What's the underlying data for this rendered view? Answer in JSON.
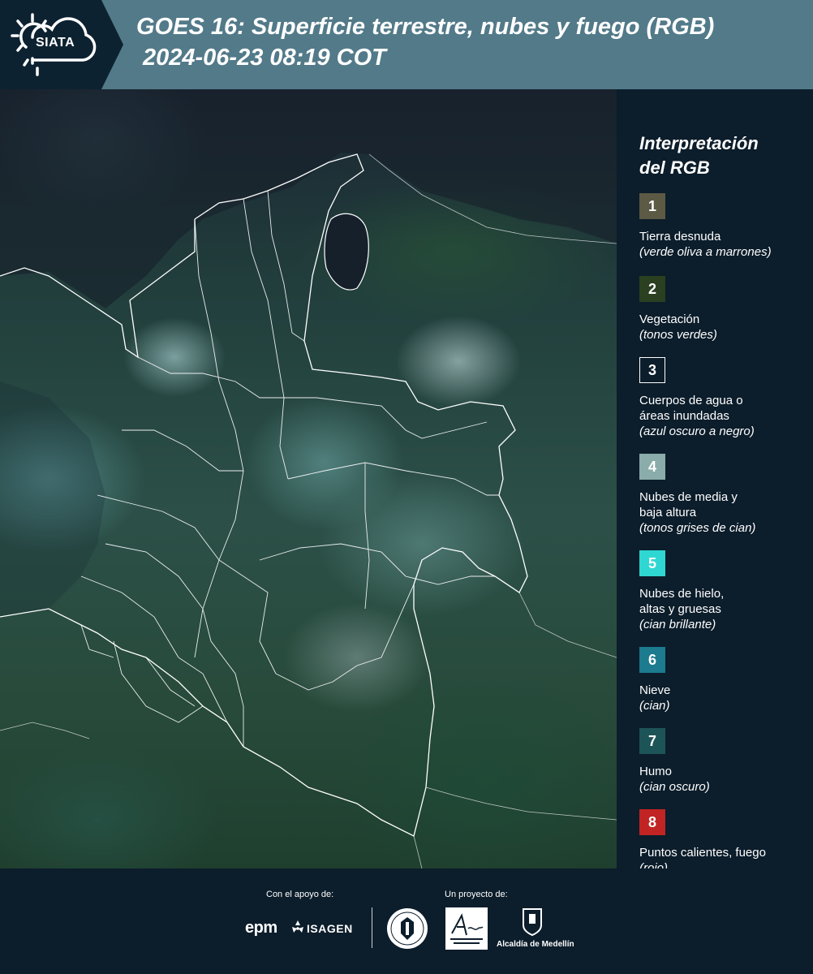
{
  "header": {
    "logo_text": "SIATA",
    "title_line1": "GOES 16: Superficie terrestre, nubes y fuego (RGB)",
    "title_line2": "2024-06-23 08:19 COT"
  },
  "legend": {
    "title": "Interpretación\ndel RGB",
    "items": [
      {
        "num": "1",
        "color": "#5c5a45",
        "label": "Tierra desnuda",
        "desc": "(verde oliva a marrones)"
      },
      {
        "num": "2",
        "color": "#2a4020",
        "label": "Vegetación",
        "desc": "(tonos verdes)"
      },
      {
        "num": "3",
        "color": "#0c1d2b",
        "label": "Cuerpos de agua o\náreas inundadas",
        "desc": "(azul oscuro a negro)"
      },
      {
        "num": "4",
        "color": "#8aacab",
        "label": "Nubes de media y\nbaja altura",
        "desc": "(tonos grises de cian)"
      },
      {
        "num": "5",
        "color": "#2fd7d2",
        "label": "Nubes de hielo,\naltas y gruesas",
        "desc": "(cian brillante)"
      },
      {
        "num": "6",
        "color": "#1c7b8e",
        "label": "Nieve",
        "desc": "(cian)"
      },
      {
        "num": "7",
        "color": "#1d5457",
        "label": "Humo",
        "desc": "(cian oscuro)"
      },
      {
        "num": "8",
        "color": "#c12423",
        "label": "Puntos calientes, fuego",
        "desc": "(rojo)"
      }
    ]
  },
  "footer": {
    "support_caption": "Con el apoyo de:",
    "project_caption": "Un proyecto de:",
    "epm_logo": "epm",
    "isagen_logo": "ISAGEN",
    "alcaldia_logo": "Alcaldía de Medellín"
  }
}
